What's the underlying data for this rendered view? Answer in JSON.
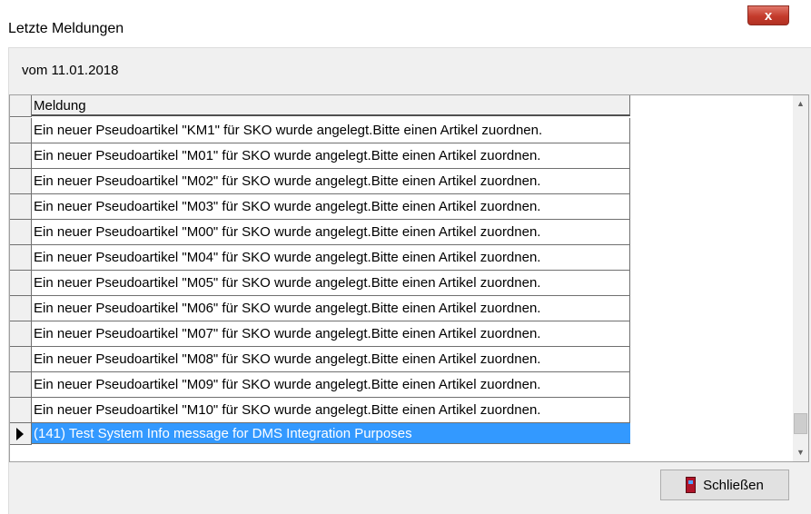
{
  "window": {
    "title": "Letzte Meldungen",
    "close_glyph": "x"
  },
  "date_label": "vom  11.01.2018",
  "grid": {
    "column_header": "Meldung",
    "rows": [
      "Ein neuer Pseudoartikel \"KM1\" für SKO wurde angelegt.Bitte einen Artikel zuordnen.",
      "Ein neuer Pseudoartikel \"M01\" für SKO wurde angelegt.Bitte einen Artikel zuordnen.",
      "Ein neuer Pseudoartikel \"M02\" für SKO wurde angelegt.Bitte einen Artikel zuordnen.",
      "Ein neuer Pseudoartikel \"M03\" für SKO wurde angelegt.Bitte einen Artikel zuordnen.",
      "Ein neuer Pseudoartikel \"M00\" für SKO wurde angelegt.Bitte einen Artikel zuordnen.",
      "Ein neuer Pseudoartikel \"M04\" für SKO wurde angelegt.Bitte einen Artikel zuordnen.",
      "Ein neuer Pseudoartikel \"M05\" für SKO wurde angelegt.Bitte einen Artikel zuordnen.",
      "Ein neuer Pseudoartikel \"M06\" für SKO wurde angelegt.Bitte einen Artikel zuordnen.",
      "Ein neuer Pseudoartikel \"M07\" für SKO wurde angelegt.Bitte einen Artikel zuordnen.",
      "Ein neuer Pseudoartikel \"M08\" für SKO wurde angelegt.Bitte einen Artikel zuordnen.",
      "Ein neuer Pseudoartikel \"M09\" für SKO wurde angelegt.Bitte einen Artikel zuordnen.",
      "Ein neuer Pseudoartikel \"M10\" für SKO wurde angelegt.Bitte einen Artikel zuordnen."
    ],
    "selected_row": "(141) Test System Info message for DMS Integration Purposes"
  },
  "buttons": {
    "close_label": "Schließen"
  },
  "colors": {
    "selection": "#3399ff",
    "close_button_red": "#c43b2b"
  },
  "icons": {
    "close": "close-icon",
    "door": "door-icon",
    "scroll_up": "scroll-up-icon",
    "scroll_down": "scroll-down-icon"
  }
}
